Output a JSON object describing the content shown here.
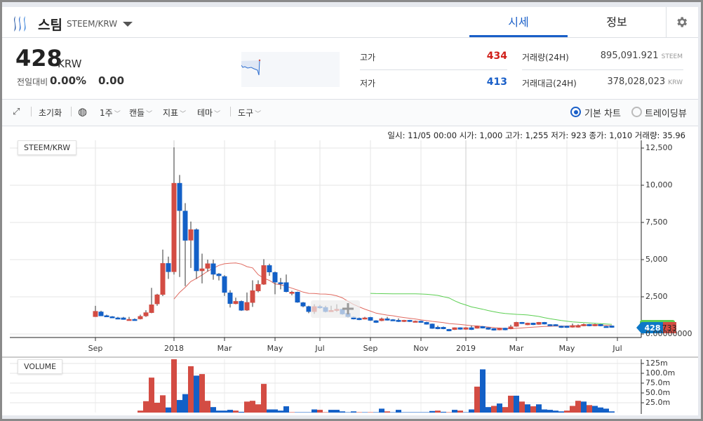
{
  "header": {
    "coin_name": "스팀",
    "pair": "STEEM/KRW",
    "tabs": [
      {
        "label": "시세",
        "active": true
      },
      {
        "label": "정보",
        "active": false
      }
    ]
  },
  "price": {
    "value": "428",
    "unit": "KRW",
    "change_label": "전일대비",
    "change_pct": "0.00%",
    "change_amt": "0.00"
  },
  "stats": {
    "high_label": "고가",
    "high": "434",
    "low_label": "저가",
    "low": "413",
    "vol_label": "거래량(24H)",
    "vol": "895,091.921",
    "vol_unit": "STEEM",
    "amt_label": "거래대금(24H)",
    "amt": "378,028,023",
    "amt_unit": "KRW"
  },
  "toolbar": {
    "reset": "초기화",
    "interval": "1주",
    "candle": "캔들",
    "indicator": "지표",
    "theme": "테마",
    "tools": "도구",
    "basic_chart": "기본 차트",
    "tradingview": "트레이딩뷰"
  },
  "info_line": "일시: 11/05 00:00 시가: 1,000 고가: 1,255 저가: 923 종가: 1,010 거래량: 35.96",
  "colors": {
    "up": "#d34c43",
    "down": "#1360c7",
    "accent": "#1a5fc8",
    "ma1": "#e06a60",
    "ma2": "#5ccf52"
  },
  "chart_data": {
    "type": "candlestick",
    "title": "STEEM/KRW",
    "volume_title": "VOLUME",
    "ylim": [
      0,
      12500
    ],
    "y_ticks": [
      "12,500",
      "10,000",
      "7,500",
      "5,000",
      "2,500",
      "0.00000000"
    ],
    "y_tick_values": [
      12500,
      10000,
      7500,
      5000,
      2500,
      0
    ],
    "x_ticks": [
      {
        "label": "Sep",
        "index": 1
      },
      {
        "label": "2018",
        "index": 15
      },
      {
        "label": "Mar",
        "index": 24
      },
      {
        "label": "May",
        "index": 33
      },
      {
        "label": "Jul",
        "index": 41
      },
      {
        "label": "Sep",
        "index": 50
      },
      {
        "label": "Nov",
        "index": 59
      },
      {
        "label": "2019",
        "index": 67
      },
      {
        "label": "Mar",
        "index": 76
      },
      {
        "label": "May",
        "index": 85
      },
      {
        "label": "Jul",
        "index": 94
      }
    ],
    "vol_ticks": [
      "125m",
      "100.0m",
      "75.0m",
      "50.0m",
      "25.0m"
    ],
    "vol_tick_values": [
      125,
      100,
      75,
      50,
      25
    ],
    "last_price": "428",
    "last_ma": "733",
    "ma_periods": [
      15,
      50
    ],
    "ohlc": [
      [
        1150,
        1890,
        1150,
        1540
      ],
      [
        1500,
        1560,
        1200,
        1200
      ],
      [
        1250,
        1300,
        1150,
        1150
      ],
      [
        1180,
        1200,
        1100,
        1100
      ],
      [
        1100,
        1150,
        1000,
        1000
      ],
      [
        1100,
        1150,
        960,
        960
      ],
      [
        930,
        1150,
        900,
        1000
      ],
      [
        1000,
        1050,
        930,
        930
      ],
      [
        1000,
        1300,
        980,
        1200
      ],
      [
        1200,
        1600,
        1150,
        1450
      ],
      [
        1420,
        3100,
        1400,
        1980
      ],
      [
        2010,
        2700,
        1900,
        2650
      ],
      [
        2640,
        5670,
        2550,
        4760
      ],
      [
        4760,
        5200,
        3700,
        4170
      ],
      [
        4170,
        12550,
        4000,
        10150
      ],
      [
        10150,
        10690,
        3830,
        8280
      ],
      [
        8280,
        8800,
        3220,
        6280
      ],
      [
        6290,
        7560,
        4440,
        7030
      ],
      [
        7030,
        7100,
        3700,
        4230
      ],
      [
        4230,
        5400,
        3400,
        4400
      ],
      [
        4400,
        5000,
        4200,
        4740
      ],
      [
        4740,
        5000,
        3650,
        4000
      ],
      [
        4050,
        4100,
        3600,
        3900
      ],
      [
        3880,
        3950,
        2560,
        2780
      ],
      [
        2780,
        2940,
        1780,
        2030
      ],
      [
        2020,
        2440,
        2000,
        2210
      ],
      [
        2210,
        2250,
        1550,
        1580
      ],
      [
        1590,
        2790,
        1550,
        2140
      ],
      [
        2100,
        3610,
        1820,
        2930
      ],
      [
        2880,
        3610,
        2800,
        3350
      ],
      [
        3330,
        5030,
        3300,
        4620
      ],
      [
        4620,
        4720,
        3910,
        4150
      ],
      [
        4150,
        4200,
        2670,
        3470
      ],
      [
        3470,
        3770,
        3000,
        3360
      ],
      [
        3470,
        4000,
        2800,
        2830
      ],
      [
        2710,
        2900,
        2600,
        2830
      ],
      [
        2830,
        2850,
        2100,
        2120
      ],
      [
        2120,
        2150,
        1800,
        1860
      ],
      [
        1860,
        1900,
        1400,
        1490
      ],
      [
        1490,
        2000,
        1350,
        1860
      ],
      [
        1860,
        1950,
        1700,
        1760
      ],
      [
        1800,
        1900,
        1450,
        1490
      ],
      [
        1520,
        1900,
        1500,
        1600
      ],
      [
        1570,
        2000,
        1500,
        1680
      ],
      [
        1680,
        1700,
        1300,
        1330
      ],
      [
        1400,
        1420,
        1100,
        1150
      ],
      [
        1150,
        1180,
        980,
        990
      ],
      [
        1070,
        1100,
        930,
        940
      ],
      [
        990,
        1150,
        980,
        1100
      ],
      [
        1130,
        1150,
        880,
        900
      ],
      [
        910,
        930,
        740,
        760
      ],
      [
        880,
        1100,
        860,
        1040
      ],
      [
        1040,
        1150,
        900,
        910
      ],
      [
        980,
        1000,
        870,
        880
      ],
      [
        940,
        1050,
        810,
        820
      ],
      [
        820,
        950,
        800,
        940
      ],
      [
        940,
        950,
        810,
        820
      ],
      [
        820,
        900,
        800,
        880
      ],
      [
        880,
        900,
        750,
        760
      ],
      [
        800,
        820,
        630,
        640
      ],
      [
        690,
        700,
        350,
        360
      ],
      [
        470,
        560,
        320,
        330
      ],
      [
        470,
        500,
        320,
        330
      ],
      [
        330,
        340,
        180,
        190
      ],
      [
        280,
        450,
        270,
        440
      ],
      [
        440,
        450,
        290,
        300
      ],
      [
        300,
        460,
        290,
        440
      ],
      [
        440,
        560,
        270,
        280
      ],
      [
        370,
        560,
        360,
        550
      ],
      [
        520,
        530,
        370,
        380
      ],
      [
        440,
        450,
        290,
        300
      ],
      [
        380,
        390,
        230,
        240
      ],
      [
        260,
        420,
        250,
        410
      ],
      [
        410,
        420,
        250,
        260
      ],
      [
        330,
        620,
        320,
        500
      ],
      [
        500,
        820,
        490,
        800
      ],
      [
        800,
        810,
        680,
        690
      ],
      [
        600,
        760,
        590,
        750
      ],
      [
        750,
        760,
        600,
        610
      ],
      [
        630,
        810,
        620,
        800
      ],
      [
        800,
        810,
        640,
        650
      ],
      [
        650,
        660,
        540,
        550
      ],
      [
        650,
        660,
        540,
        550
      ],
      [
        550,
        560,
        410,
        420
      ],
      [
        550,
        560,
        410,
        420
      ],
      [
        440,
        700,
        430,
        580
      ],
      [
        440,
        640,
        430,
        580
      ],
      [
        530,
        700,
        520,
        660
      ],
      [
        660,
        670,
        520,
        530
      ],
      [
        530,
        690,
        520,
        660
      ],
      [
        660,
        670,
        520,
        530
      ],
      [
        530,
        540,
        430,
        440
      ],
      [
        560,
        570,
        420,
        428
      ]
    ],
    "volume_m": [
      0,
      0,
      0,
      0,
      0,
      0,
      0,
      0,
      5,
      29,
      89,
      25,
      44,
      13,
      139,
      32,
      47,
      118,
      94,
      98,
      30,
      14,
      5,
      5,
      7,
      5,
      2,
      28,
      30,
      21,
      73,
      8,
      8,
      5,
      16,
      1,
      1,
      1,
      1,
      8,
      7,
      1,
      7,
      7,
      3,
      1,
      3,
      1,
      1,
      1,
      1,
      10,
      3,
      1,
      7,
      1,
      1,
      1,
      1,
      1,
      4,
      5,
      2,
      1,
      7,
      5,
      1,
      8,
      66,
      110,
      14,
      17,
      23,
      14,
      43,
      43,
      28,
      21,
      16,
      21,
      8,
      7,
      5,
      3,
      5,
      17,
      30,
      28,
      19,
      17,
      13,
      10,
      3
    ],
    "volume_dir": "00000000rrrrrbrbbrbrrbbbbrbrrrrbbbbrbbbbrrbbbbbrbrbbrbbbbbbbbrbrbrbbrbbrbrrbrbrbbbbbrrrbrbbb"
  }
}
